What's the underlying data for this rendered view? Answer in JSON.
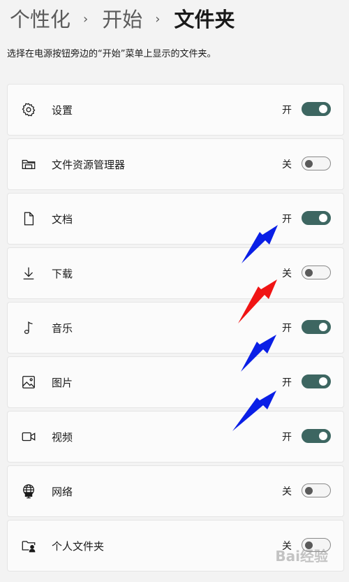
{
  "breadcrumb": {
    "items": [
      "个性化",
      "开始",
      "文件夹"
    ],
    "separator": "›"
  },
  "subtitle": "选择在电源按钮旁边的“开始”菜单上显示的文件夹。",
  "folders": [
    {
      "label": "设置",
      "icon": "gear-icon",
      "state": "开",
      "on": true
    },
    {
      "label": "文件资源管理器",
      "icon": "folder-icon",
      "state": "关",
      "on": false
    },
    {
      "label": "文档",
      "icon": "document-icon",
      "state": "开",
      "on": true
    },
    {
      "label": "下载",
      "icon": "download-icon",
      "state": "关",
      "on": false
    },
    {
      "label": "音乐",
      "icon": "music-note-icon",
      "state": "开",
      "on": true
    },
    {
      "label": "图片",
      "icon": "picture-icon",
      "state": "开",
      "on": true
    },
    {
      "label": "视频",
      "icon": "video-camera-icon",
      "state": "开",
      "on": true
    },
    {
      "label": "网络",
      "icon": "network-globe-icon",
      "state": "关",
      "on": false
    },
    {
      "label": "个人文件夹",
      "icon": "personal-folder-icon",
      "state": "关",
      "on": false
    }
  ],
  "annotations": {
    "arrow_colors": {
      "blue": "#0a1fe6",
      "red": "#f01414"
    }
  },
  "watermark": "Bai经验"
}
